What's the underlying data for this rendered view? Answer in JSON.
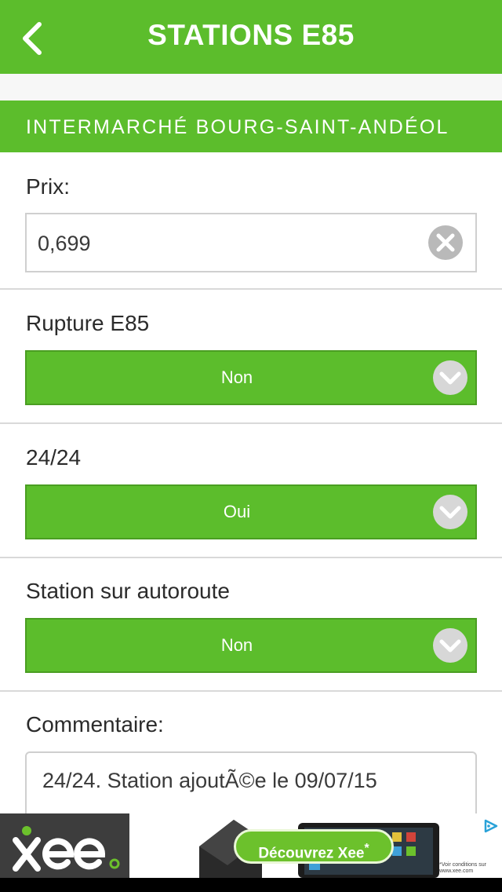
{
  "header": {
    "title": "STATIONS E85",
    "back_icon": "chevron-left-icon"
  },
  "station": {
    "name": "INTERMARCHÉ BOURG-SAINT-ANDÉOL"
  },
  "price": {
    "label": "Prix:",
    "value": "0,699",
    "clear_icon": "clear-circle-icon"
  },
  "rupture": {
    "label": "Rupture E85",
    "value": "Non"
  },
  "open24": {
    "label": "24/24",
    "value": "Oui"
  },
  "motorway": {
    "label": "Station sur autoroute",
    "value": "Non"
  },
  "comment": {
    "label": "Commentaire:",
    "value": "24/24. Station ajoutÃ©e le 09/07/15"
  },
  "ad": {
    "logo_text": "xee",
    "cta": "Découvrez Xee",
    "cta_mark": "*",
    "fine_print": "*Voir conditions sur www.xee.com",
    "choices_icon": "ad-choices-icon"
  },
  "colors": {
    "brand_green": "#5cbd2c",
    "border_gray": "#cfcfcf"
  }
}
